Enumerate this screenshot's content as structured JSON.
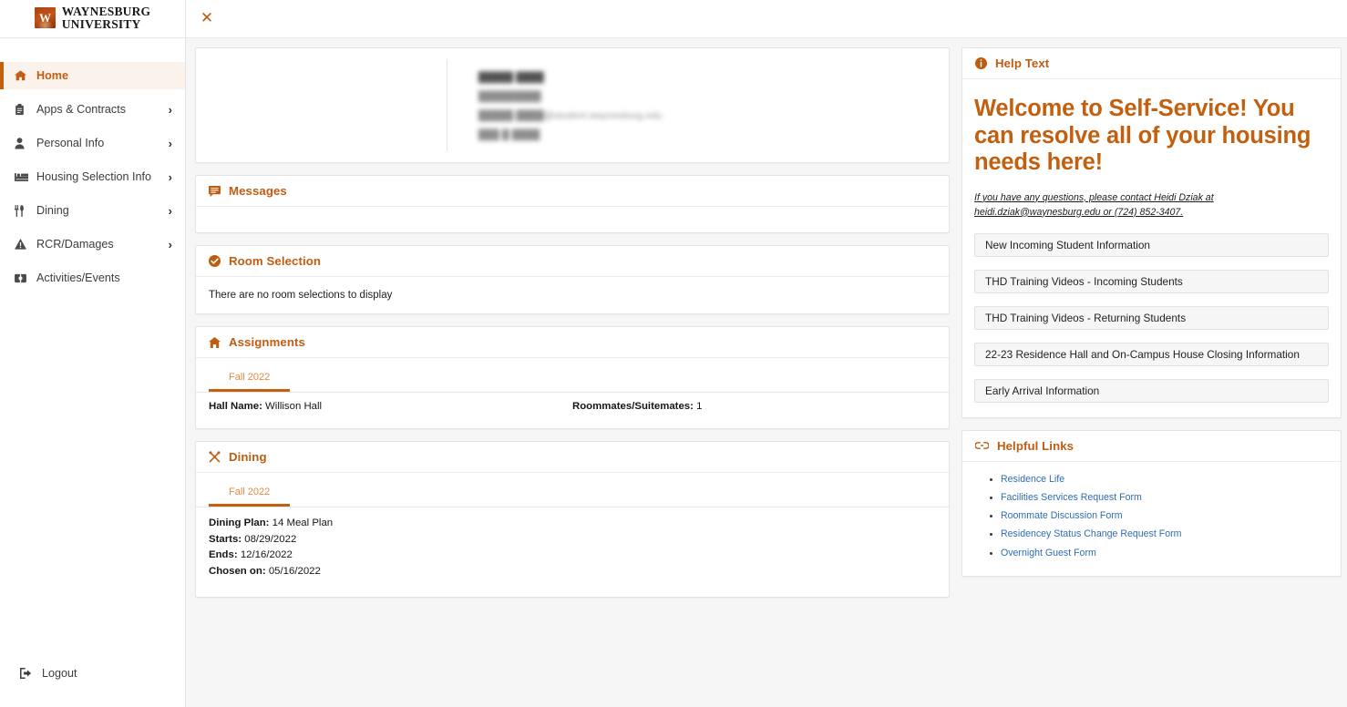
{
  "brand": {
    "mark_letter": "W",
    "line1": "WAYNESBURG",
    "line2": "UNIVERSITY"
  },
  "sidebar": {
    "items": [
      {
        "label": "Home",
        "icon": "home-icon",
        "active": true,
        "has_chevron": false
      },
      {
        "label": "Apps & Contracts",
        "icon": "clipboard-icon",
        "active": false,
        "has_chevron": true
      },
      {
        "label": "Personal Info",
        "icon": "user-icon",
        "active": false,
        "has_chevron": true
      },
      {
        "label": "Housing Selection Info",
        "icon": "bed-icon",
        "active": false,
        "has_chevron": true
      },
      {
        "label": "Dining",
        "icon": "utensils-icon",
        "active": false,
        "has_chevron": true
      },
      {
        "label": "RCR/Damages",
        "icon": "warning-triangle-icon",
        "active": false,
        "has_chevron": true
      },
      {
        "label": "Activities/Events",
        "icon": "ticket-icon",
        "active": false,
        "has_chevron": false
      }
    ],
    "logout": {
      "label": "Logout",
      "icon": "logout-icon"
    }
  },
  "topbar": {
    "close_icon": "close-icon",
    "close_label": "✕"
  },
  "profile": {
    "name": "█████ ████",
    "id": "█████████",
    "email": "█████.████@student.waynesburg.edu",
    "dob": "███ █ ████",
    "redacted": true
  },
  "messages": {
    "icon": "message-icon",
    "title": "Messages",
    "items": []
  },
  "room_selection": {
    "icon": "check-circle-icon",
    "title": "Room Selection",
    "empty_text": "There are no room selections to display"
  },
  "assignments": {
    "icon": "house-icon",
    "title": "Assignments",
    "tabs": [
      {
        "label": "Fall 2022",
        "active": true
      }
    ],
    "fields": [
      {
        "label": "Hall Name:",
        "value": "Willison Hall"
      },
      {
        "label": "Roommates/Suitemates:",
        "value": "1"
      }
    ]
  },
  "dining": {
    "icon": "utensils-crossed-icon",
    "title": "Dining",
    "tabs": [
      {
        "label": "Fall 2022",
        "active": true
      }
    ],
    "fields": [
      {
        "label": "Dining Plan:",
        "value": "14 Meal Plan"
      },
      {
        "label": "Starts:",
        "value": "08/29/2022"
      },
      {
        "label": "Ends:",
        "value": "12/16/2022"
      },
      {
        "label": "Chosen on:",
        "value": "05/16/2022"
      }
    ]
  },
  "help_text": {
    "icon": "info-circle-icon",
    "title": "Help Text",
    "headline": "Welcome to Self-Service! You can resolve all of your housing needs here!",
    "note": "If you have any questions, please contact Heidi Dziak at heidi.dziak@waynesburg.edu or (724) 852-3407.",
    "accordion": [
      "New Incoming Student Information",
      "THD Training Videos - Incoming Students",
      "THD Training Videos - Returning Students",
      "22-23 Residence Hall and On-Campus House Closing Information",
      "Early Arrival Information"
    ]
  },
  "helpful_links": {
    "icon": "link-icon",
    "title": "Helpful Links",
    "links": [
      "Residence Life",
      "Facilities Services Request Form",
      "Roommate Discussion Form",
      "Residencey Status Change Request Form",
      "Overnight Guest Form"
    ]
  },
  "colors": {
    "accent_orange": "#bf5c11",
    "accent_orange_light": "#e08a42",
    "active_nav_bg": "#fbf3eb",
    "page_bg": "#f6f6f6",
    "card_bg": "#ffffff",
    "link_blue": "#2f6db5"
  }
}
